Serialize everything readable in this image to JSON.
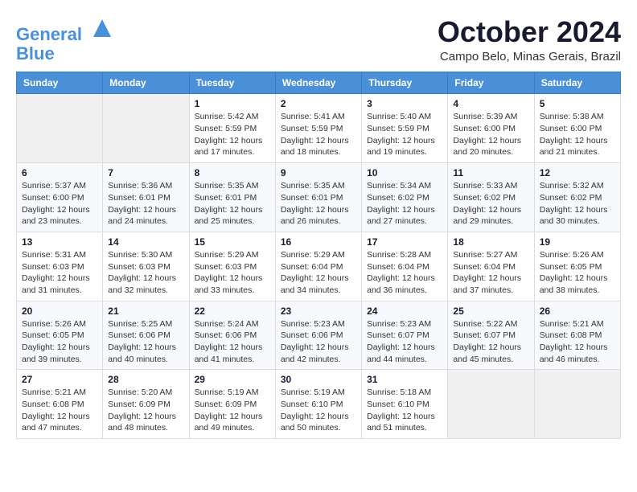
{
  "header": {
    "logo_line1": "General",
    "logo_line2": "Blue",
    "month_title": "October 2024",
    "location": "Campo Belo, Minas Gerais, Brazil"
  },
  "weekdays": [
    "Sunday",
    "Monday",
    "Tuesday",
    "Wednesday",
    "Thursday",
    "Friday",
    "Saturday"
  ],
  "weeks": [
    [
      {
        "day": "",
        "sunrise": "",
        "sunset": "",
        "daylight": ""
      },
      {
        "day": "",
        "sunrise": "",
        "sunset": "",
        "daylight": ""
      },
      {
        "day": "1",
        "sunrise": "Sunrise: 5:42 AM",
        "sunset": "Sunset: 5:59 PM",
        "daylight": "Daylight: 12 hours and 17 minutes."
      },
      {
        "day": "2",
        "sunrise": "Sunrise: 5:41 AM",
        "sunset": "Sunset: 5:59 PM",
        "daylight": "Daylight: 12 hours and 18 minutes."
      },
      {
        "day": "3",
        "sunrise": "Sunrise: 5:40 AM",
        "sunset": "Sunset: 5:59 PM",
        "daylight": "Daylight: 12 hours and 19 minutes."
      },
      {
        "day": "4",
        "sunrise": "Sunrise: 5:39 AM",
        "sunset": "Sunset: 6:00 PM",
        "daylight": "Daylight: 12 hours and 20 minutes."
      },
      {
        "day": "5",
        "sunrise": "Sunrise: 5:38 AM",
        "sunset": "Sunset: 6:00 PM",
        "daylight": "Daylight: 12 hours and 21 minutes."
      }
    ],
    [
      {
        "day": "6",
        "sunrise": "Sunrise: 5:37 AM",
        "sunset": "Sunset: 6:00 PM",
        "daylight": "Daylight: 12 hours and 23 minutes."
      },
      {
        "day": "7",
        "sunrise": "Sunrise: 5:36 AM",
        "sunset": "Sunset: 6:01 PM",
        "daylight": "Daylight: 12 hours and 24 minutes."
      },
      {
        "day": "8",
        "sunrise": "Sunrise: 5:35 AM",
        "sunset": "Sunset: 6:01 PM",
        "daylight": "Daylight: 12 hours and 25 minutes."
      },
      {
        "day": "9",
        "sunrise": "Sunrise: 5:35 AM",
        "sunset": "Sunset: 6:01 PM",
        "daylight": "Daylight: 12 hours and 26 minutes."
      },
      {
        "day": "10",
        "sunrise": "Sunrise: 5:34 AM",
        "sunset": "Sunset: 6:02 PM",
        "daylight": "Daylight: 12 hours and 27 minutes."
      },
      {
        "day": "11",
        "sunrise": "Sunrise: 5:33 AM",
        "sunset": "Sunset: 6:02 PM",
        "daylight": "Daylight: 12 hours and 29 minutes."
      },
      {
        "day": "12",
        "sunrise": "Sunrise: 5:32 AM",
        "sunset": "Sunset: 6:02 PM",
        "daylight": "Daylight: 12 hours and 30 minutes."
      }
    ],
    [
      {
        "day": "13",
        "sunrise": "Sunrise: 5:31 AM",
        "sunset": "Sunset: 6:03 PM",
        "daylight": "Daylight: 12 hours and 31 minutes."
      },
      {
        "day": "14",
        "sunrise": "Sunrise: 5:30 AM",
        "sunset": "Sunset: 6:03 PM",
        "daylight": "Daylight: 12 hours and 32 minutes."
      },
      {
        "day": "15",
        "sunrise": "Sunrise: 5:29 AM",
        "sunset": "Sunset: 6:03 PM",
        "daylight": "Daylight: 12 hours and 33 minutes."
      },
      {
        "day": "16",
        "sunrise": "Sunrise: 5:29 AM",
        "sunset": "Sunset: 6:04 PM",
        "daylight": "Daylight: 12 hours and 34 minutes."
      },
      {
        "day": "17",
        "sunrise": "Sunrise: 5:28 AM",
        "sunset": "Sunset: 6:04 PM",
        "daylight": "Daylight: 12 hours and 36 minutes."
      },
      {
        "day": "18",
        "sunrise": "Sunrise: 5:27 AM",
        "sunset": "Sunset: 6:04 PM",
        "daylight": "Daylight: 12 hours and 37 minutes."
      },
      {
        "day": "19",
        "sunrise": "Sunrise: 5:26 AM",
        "sunset": "Sunset: 6:05 PM",
        "daylight": "Daylight: 12 hours and 38 minutes."
      }
    ],
    [
      {
        "day": "20",
        "sunrise": "Sunrise: 5:26 AM",
        "sunset": "Sunset: 6:05 PM",
        "daylight": "Daylight: 12 hours and 39 minutes."
      },
      {
        "day": "21",
        "sunrise": "Sunrise: 5:25 AM",
        "sunset": "Sunset: 6:06 PM",
        "daylight": "Daylight: 12 hours and 40 minutes."
      },
      {
        "day": "22",
        "sunrise": "Sunrise: 5:24 AM",
        "sunset": "Sunset: 6:06 PM",
        "daylight": "Daylight: 12 hours and 41 minutes."
      },
      {
        "day": "23",
        "sunrise": "Sunrise: 5:23 AM",
        "sunset": "Sunset: 6:06 PM",
        "daylight": "Daylight: 12 hours and 42 minutes."
      },
      {
        "day": "24",
        "sunrise": "Sunrise: 5:23 AM",
        "sunset": "Sunset: 6:07 PM",
        "daylight": "Daylight: 12 hours and 44 minutes."
      },
      {
        "day": "25",
        "sunrise": "Sunrise: 5:22 AM",
        "sunset": "Sunset: 6:07 PM",
        "daylight": "Daylight: 12 hours and 45 minutes."
      },
      {
        "day": "26",
        "sunrise": "Sunrise: 5:21 AM",
        "sunset": "Sunset: 6:08 PM",
        "daylight": "Daylight: 12 hours and 46 minutes."
      }
    ],
    [
      {
        "day": "27",
        "sunrise": "Sunrise: 5:21 AM",
        "sunset": "Sunset: 6:08 PM",
        "daylight": "Daylight: 12 hours and 47 minutes."
      },
      {
        "day": "28",
        "sunrise": "Sunrise: 5:20 AM",
        "sunset": "Sunset: 6:09 PM",
        "daylight": "Daylight: 12 hours and 48 minutes."
      },
      {
        "day": "29",
        "sunrise": "Sunrise: 5:19 AM",
        "sunset": "Sunset: 6:09 PM",
        "daylight": "Daylight: 12 hours and 49 minutes."
      },
      {
        "day": "30",
        "sunrise": "Sunrise: 5:19 AM",
        "sunset": "Sunset: 6:10 PM",
        "daylight": "Daylight: 12 hours and 50 minutes."
      },
      {
        "day": "31",
        "sunrise": "Sunrise: 5:18 AM",
        "sunset": "Sunset: 6:10 PM",
        "daylight": "Daylight: 12 hours and 51 minutes."
      },
      {
        "day": "",
        "sunrise": "",
        "sunset": "",
        "daylight": ""
      },
      {
        "day": "",
        "sunrise": "",
        "sunset": "",
        "daylight": ""
      }
    ]
  ]
}
